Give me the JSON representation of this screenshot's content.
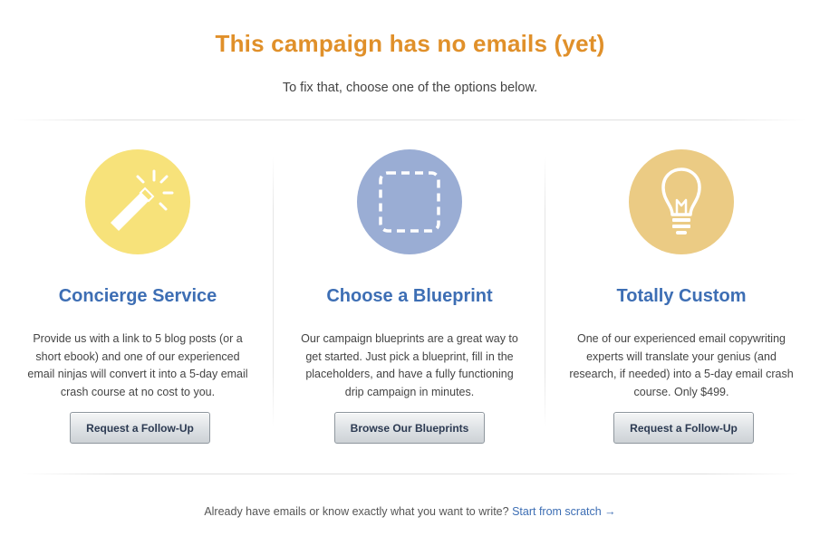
{
  "header": {
    "title": "This campaign has no emails (yet)",
    "subtitle": "To fix that, choose one of the options below."
  },
  "options": [
    {
      "title": "Concierge Service",
      "icon": "magic-wand-icon",
      "icon_bg": "#f7e27a",
      "description": "Provide us with a link to 5 blog posts (or a short ebook) and one of our experienced email ninjas will convert it into a 5-day email crash course at no cost to you.",
      "button_label": "Request a Follow-Up"
    },
    {
      "title": "Choose a Blueprint",
      "icon": "dashed-square-icon",
      "icon_bg": "#9aadd4",
      "description": "Our campaign blueprints are a great way to get started. Just pick a blueprint, fill in the placeholders, and have a fully functioning drip campaign in minutes.",
      "button_label": "Browse Our Blueprints"
    },
    {
      "title": "Totally Custom",
      "icon": "lightbulb-icon",
      "icon_bg": "#ebcb84",
      "description": "One of our experienced email copywriting experts will translate your genius (and research, if needed) into a 5-day email crash course. Only $499.",
      "button_label": "Request a Follow-Up"
    }
  ],
  "footer": {
    "text": "Already have emails or know exactly what you want to write?",
    "link_label": "Start from scratch →"
  },
  "colors": {
    "title": "#e0902a",
    "heading": "#3d6eb4",
    "link": "#3d6eb4"
  }
}
